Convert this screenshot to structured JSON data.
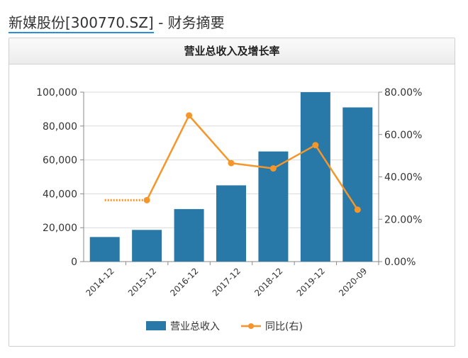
{
  "header": {
    "stock": "新媒股份[300770.SZ]",
    "suffix": " - 财务摘要"
  },
  "panel": {
    "title": "营业总收入及增长率"
  },
  "colors": {
    "bar": "#2878a8",
    "line": "#f5962a",
    "grid": "#d9d9d9"
  },
  "chart_data": {
    "type": "bar",
    "categories": [
      "2014-12",
      "2015-12",
      "2016-12",
      "2017-12",
      "2018-12",
      "2019-12",
      "2020-09"
    ],
    "series": [
      {
        "name": "营业总收入",
        "type": "bar",
        "axis": "left",
        "values": [
          14500,
          18700,
          31000,
          45000,
          65000,
          100000,
          91000
        ]
      },
      {
        "name": "同比(右)",
        "type": "line",
        "axis": "right",
        "values": [
          null,
          29,
          69,
          46.5,
          44,
          55,
          24.5
        ]
      }
    ],
    "left_axis": {
      "min": 0,
      "max": 100000,
      "ticks": [
        0,
        20000,
        40000,
        60000,
        80000,
        100000
      ],
      "tick_labels": [
        "0",
        "20,000",
        "40,000",
        "60,000",
        "80,000",
        "100,000"
      ]
    },
    "right_axis": {
      "min": 0,
      "max": 80,
      "ticks": [
        0,
        20,
        40,
        60,
        80
      ],
      "tick_labels": [
        "0.00%",
        "20.00%",
        "40.00%",
        "60.00%",
        "80.00%"
      ]
    },
    "legend": [
      "营业总收入",
      "同比(右)"
    ],
    "legend_position": "bottom-center",
    "grid": true
  }
}
